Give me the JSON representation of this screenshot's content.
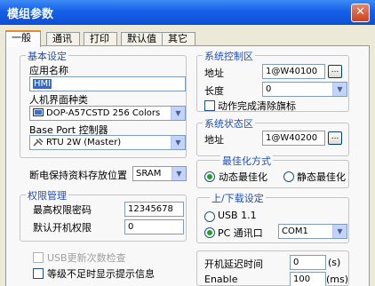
{
  "window": {
    "title": "模组参数",
    "close_label": "✕"
  },
  "tabs": [
    {
      "label": "一般"
    },
    {
      "label": "通讯"
    },
    {
      "label": "打印"
    },
    {
      "label": "默认值"
    },
    {
      "label": "其它"
    }
  ],
  "basic": {
    "group_label": "基本设定",
    "app_name_label": "应用名称",
    "app_name_value": "HMI",
    "hmi_type_label": "人机界面种类",
    "hmi_type_value": "DOP-A57CSTD 256 Colors",
    "base_port_label": "Base Port 控制器",
    "base_port_value": "RTU 2W (Master)"
  },
  "power_save": {
    "label": "断电保持资料存放位置",
    "value": "SRAM"
  },
  "auth": {
    "group_label": "权限管理",
    "max_pwd_label": "最高权限密码",
    "max_pwd_value": "12345678",
    "default_label": "默认开机权限",
    "default_value": "0"
  },
  "usb_update": {
    "label": "USB更新次数检查"
  },
  "level_hint": {
    "label": "等级不足时显示提示信息"
  },
  "control": {
    "group_label": "系统控制区",
    "addr_label": "地址",
    "addr_value": "1@W40100",
    "len_label": "长度",
    "len_value": "0",
    "clear_label": "动作完成清除旗标",
    "btn_label": "..."
  },
  "status": {
    "group_label": "系统状态区",
    "addr_label": "地址",
    "addr_value": "1@W40200",
    "btn_label": "..."
  },
  "optimize": {
    "group_label": "最佳化方式",
    "dynamic_label": "动态最佳化",
    "static_label": "静态最佳化"
  },
  "transfer": {
    "group_label": "上/下载设定",
    "usb_label": "USB 1.1",
    "pc_label": "PC 通讯口",
    "pc_value": "COM1"
  },
  "boot": {
    "delay_label": "开机延迟时间",
    "delay_value": "0",
    "delay_unit": "(s)",
    "enable_label": "Enable",
    "enable_value": "100",
    "enable_unit": "(ms)"
  }
}
